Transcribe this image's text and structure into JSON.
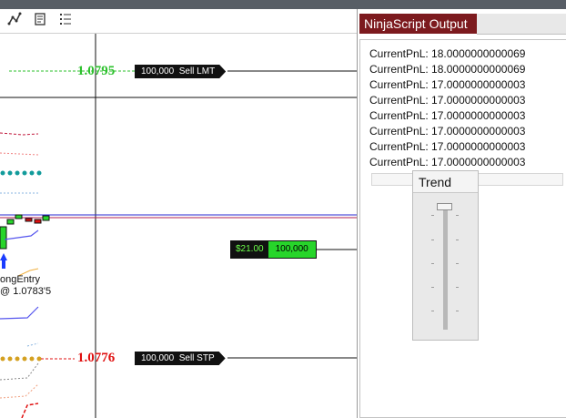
{
  "toolbar": {
    "buttons": [
      {
        "name": "draw-line-tool",
        "icon": "line-chart-icon"
      },
      {
        "name": "properties-tool",
        "icon": "properties-icon"
      },
      {
        "name": "list-tool",
        "icon": "list-icon"
      }
    ]
  },
  "chart": {
    "orders": [
      {
        "price": "1.0795",
        "qty": "100,000",
        "type": "Sell LMT",
        "price_color": "#2ec12e"
      },
      {
        "price": "1.0776",
        "qty": "100,000",
        "type": "Sell STP",
        "price_color": "#e01010"
      }
    ],
    "position": {
      "pnl": "$21.00",
      "qty": "100,000"
    },
    "entry_signal": {
      "name": "ongEntry",
      "fill": "@ 1.0783'5"
    }
  },
  "output_window": {
    "title": "NinjaScript Output",
    "lines": [
      "CurrentPnL: 18.0000000000069",
      "CurrentPnL: 18.0000000000069",
      "CurrentPnL: 17.0000000000003",
      "CurrentPnL: 17.0000000000003",
      "CurrentPnL: 17.0000000000003",
      "CurrentPnL: 17.0000000000003",
      "CurrentPnL: 17.0000000000003",
      "CurrentPnL: 17.0000000000003"
    ]
  },
  "trend_panel": {
    "title": "Trend",
    "slider_level": 1.0
  },
  "colors": {
    "output_tab": "#7c1a1e",
    "sell_limit_price": "#2ec12e",
    "sell_stop_price": "#e01010",
    "position_qty": "#27d52a"
  }
}
